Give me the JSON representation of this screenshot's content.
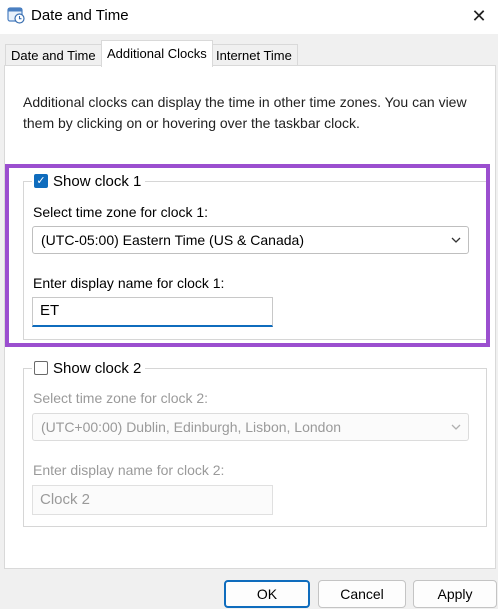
{
  "window": {
    "title": "Date and Time",
    "close_icon": "close-icon",
    "app_icon": "calendar-clock-icon"
  },
  "tabs": [
    {
      "label": "Date and Time",
      "active": false
    },
    {
      "label": "Additional Clocks",
      "active": true
    },
    {
      "label": "Internet Time",
      "active": false
    }
  ],
  "description": "Additional clocks can display the time in other time zones. You can view them by clicking on or hovering over the taskbar clock.",
  "clock1": {
    "show_label": "Show clock 1",
    "checked": true,
    "timezone_label": "Select time zone for clock 1:",
    "timezone_value": "(UTC-05:00) Eastern Time (US & Canada)",
    "display_label": "Enter display name for clock 1:",
    "display_value": "ET"
  },
  "clock2": {
    "show_label": "Show clock 2",
    "checked": false,
    "timezone_label": "Select time zone for clock 2:",
    "timezone_value": "(UTC+00:00) Dublin, Edinburgh, Lisbon, London",
    "display_label": "Enter display name for clock 2:",
    "display_value": "Clock 2"
  },
  "buttons": {
    "ok": "OK",
    "cancel": "Cancel",
    "apply": "Apply"
  },
  "colors": {
    "accent": "#0f6cbd",
    "highlight": "#9b4fcf"
  }
}
